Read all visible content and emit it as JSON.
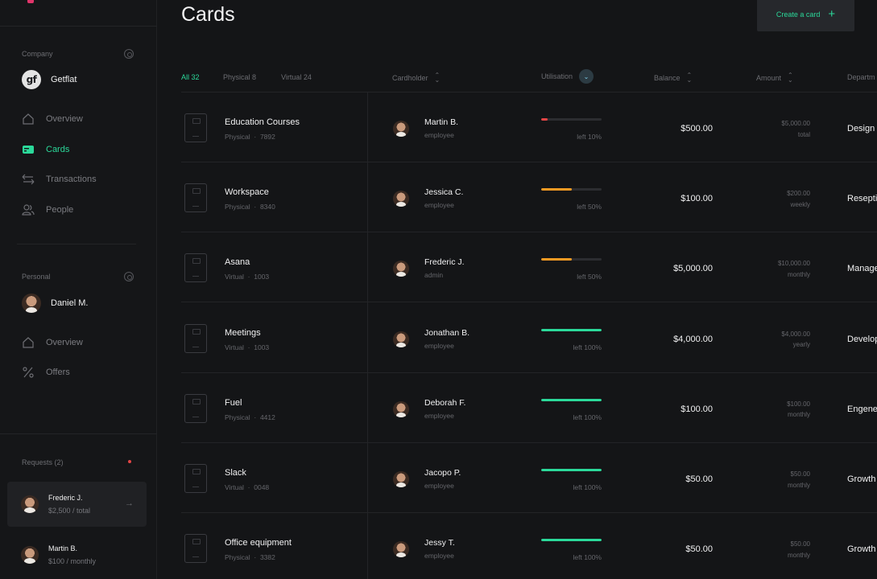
{
  "page": {
    "title": "Cards",
    "create_button": "Create a card"
  },
  "sidebar": {
    "company_label": "Company",
    "company_badge": "gf",
    "company_name": "Getflat",
    "company_nav": [
      {
        "label": "Overview",
        "icon": "home-icon",
        "active": false
      },
      {
        "label": "Cards",
        "icon": "card-icon",
        "active": true
      },
      {
        "label": "Transactions",
        "icon": "transactions-icon",
        "active": false
      },
      {
        "label": "People",
        "icon": "people-icon",
        "active": false
      }
    ],
    "personal_label": "Personal",
    "personal_name": "Daniel M.",
    "personal_nav": [
      {
        "label": "Overview",
        "icon": "home-icon"
      },
      {
        "label": "Offers",
        "icon": "percent-icon"
      }
    ],
    "requests_label": "Requests (2)",
    "requests": [
      {
        "name": "Frederic J.",
        "detail": "$2,500 / total"
      },
      {
        "name": "Martin B.",
        "detail": "$100 / monthly"
      }
    ]
  },
  "table": {
    "tabs": [
      "All 32",
      "Physical 8",
      "Virtual 24"
    ],
    "headers": {
      "cardholder": "Cardholder",
      "utilisation": "Utilisation",
      "balance": "Balance",
      "amount": "Amount",
      "department": "Departm"
    },
    "rows": [
      {
        "card": "Education Courses",
        "type": "Physical",
        "number": "7892",
        "holder": "Martin B.",
        "role": "employee",
        "util_left": 0.1,
        "util_label": "left 10%",
        "balance": "$500.00",
        "amount": "$5,000.00",
        "period": "total",
        "dept": "Design"
      },
      {
        "card": "Workspace",
        "type": "Physical",
        "number": "8340",
        "holder": "Jessica C.",
        "role": "employee",
        "util_left": 0.5,
        "util_label": "left 50%",
        "balance": "$100.00",
        "amount": "$200.00",
        "period": "weekly",
        "dept": "Resepti"
      },
      {
        "card": "Asana",
        "type": "Virtual",
        "number": "1003",
        "holder": "Frederic J.",
        "role": "admin",
        "util_left": 0.5,
        "util_label": "left 50%",
        "balance": "$5,000.00",
        "amount": "$10,000.00",
        "period": "monthly",
        "dept": "Manage"
      },
      {
        "card": "Meetings",
        "type": "Virtual",
        "number": "1003",
        "holder": "Jonathan B.",
        "role": "employee",
        "util_left": 1.0,
        "util_label": "left 100%",
        "balance": "$4,000.00",
        "amount": "$4,000.00",
        "period": "yearly",
        "dept": "Develop"
      },
      {
        "card": "Fuel",
        "type": "Physical",
        "number": "4412",
        "holder": "Deborah F.",
        "role": "employee",
        "util_left": 1.0,
        "util_label": "left 100%",
        "balance": "$100.00",
        "amount": "$100.00",
        "period": "monthly",
        "dept": "Engene"
      },
      {
        "card": "Slack",
        "type": "Virtual",
        "number": "0048",
        "holder": "Jacopo P.",
        "role": "employee",
        "util_left": 1.0,
        "util_label": "left 100%",
        "balance": "$50.00",
        "amount": "$50.00",
        "period": "monthly",
        "dept": "Growth"
      },
      {
        "card": "Office equipment",
        "type": "Physical",
        "number": "3382",
        "holder": "Jessy T.",
        "role": "employee",
        "util_left": 1.0,
        "util_label": "left 100%",
        "balance": "$50.00",
        "amount": "$50.00",
        "period": "monthly",
        "dept": "Growth"
      }
    ]
  },
  "colors": {
    "accent": "#2bd99a",
    "warning": "#f59a23",
    "danger": "#e24545"
  }
}
